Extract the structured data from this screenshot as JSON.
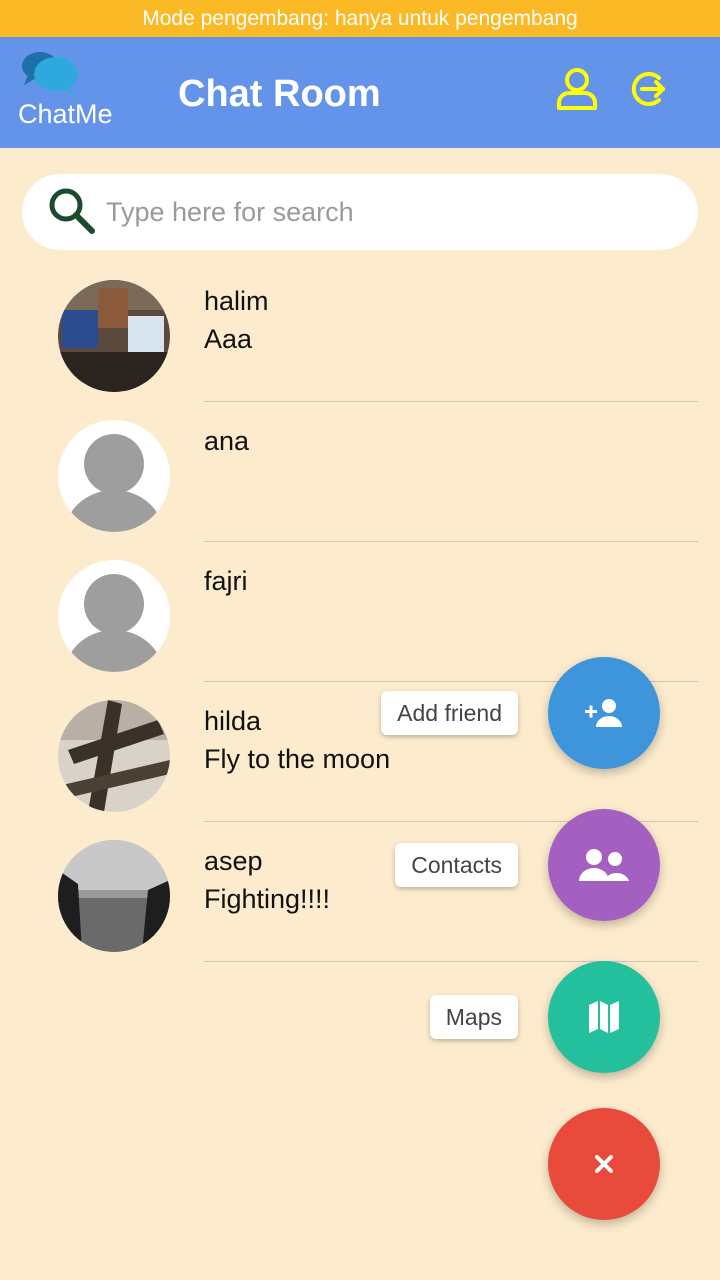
{
  "banner": {
    "text": "Mode pengembang: hanya untuk pengembang"
  },
  "header": {
    "logo_text": "ChatMe",
    "title": "Chat Room",
    "profile_icon": "user-icon",
    "logout_icon": "logout-icon",
    "accent_color": "#ffff00"
  },
  "search": {
    "placeholder": "Type here for search",
    "value": ""
  },
  "chats": [
    {
      "name": "halim",
      "message": "Aaa",
      "avatar": "photo-laptops"
    },
    {
      "name": "ana",
      "message": "",
      "avatar": "default-avatar"
    },
    {
      "name": "fajri",
      "message": "",
      "avatar": "default-avatar"
    },
    {
      "name": "hilda",
      "message": "Fly to the moon",
      "avatar": "photo-grate"
    },
    {
      "name": "asep",
      "message": "Fighting!!!!",
      "avatar": "photo-beach"
    }
  ],
  "fab_menu": {
    "add_friend": {
      "label": "Add friend",
      "color": "#3f95dc",
      "icon": "add-user-icon"
    },
    "contacts": {
      "label": "Contacts",
      "color": "#a460c1",
      "icon": "users-icon"
    },
    "maps": {
      "label": "Maps",
      "color": "#24c09d",
      "icon": "map-icon"
    },
    "close": {
      "color": "#e84a3c",
      "icon": "close-icon"
    }
  }
}
